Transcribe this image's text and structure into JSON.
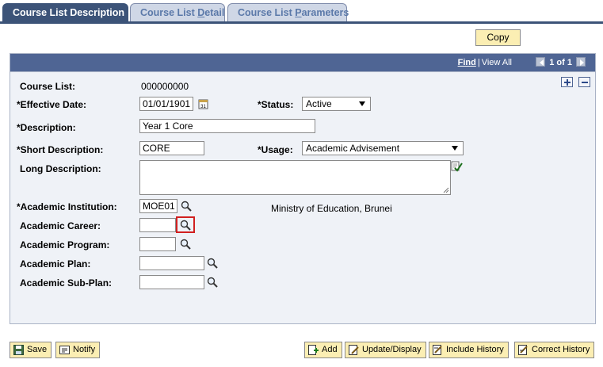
{
  "tabs": [
    {
      "label": "Course List Description",
      "active": true
    },
    {
      "label_pre": "Course List ",
      "label_u": "D",
      "label_post": "etail",
      "active": false
    },
    {
      "label_pre": "Course List ",
      "label_u": "P",
      "label_post": "arameters",
      "active": false
    }
  ],
  "copy_label": "Copy",
  "nav": {
    "find": "Find",
    "view_all": "View All",
    "pager": "1 of 1"
  },
  "form": {
    "course_list": {
      "label": "Course List:",
      "value": "000000000"
    },
    "effective_date": {
      "label": "*Effective Date:",
      "value": "01/01/1901"
    },
    "status": {
      "label": "*Status:",
      "value": "Active"
    },
    "description": {
      "label": "*Description:",
      "value": "Year 1 Core"
    },
    "short_description": {
      "label": "*Short Description:",
      "value": "CORE"
    },
    "usage": {
      "label": "*Usage:",
      "value": "Academic Advisement"
    },
    "long_description": {
      "label": "Long Description:",
      "value": ""
    },
    "institution": {
      "label": "*Academic Institution:",
      "value": "MOE01",
      "description": "Ministry of Education, Brunei"
    },
    "career": {
      "label": "Academic Career:",
      "value": ""
    },
    "program": {
      "label": "Academic Program:",
      "value": ""
    },
    "plan": {
      "label": "Academic Plan:",
      "value": ""
    },
    "subplan": {
      "label": "Academic Sub-Plan:",
      "value": ""
    }
  },
  "buttons": {
    "save": "Save",
    "notify": "Notify",
    "add": "Add",
    "update_display": "Update/Display",
    "include_history": "Include History",
    "correct_history": "Correct History"
  },
  "colors": {
    "tab_active": "#3c5378",
    "panel_header": "#4f6594",
    "button_bg": "#fbeeb3",
    "highlight": "#d12020"
  }
}
